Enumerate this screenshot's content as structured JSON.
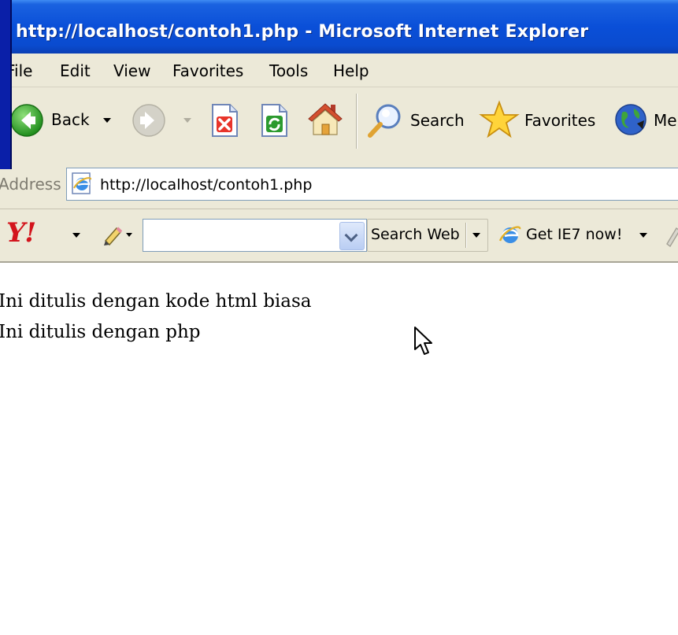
{
  "window": {
    "title": "http://localhost/contoh1.php - Microsoft Internet Explorer"
  },
  "menu": {
    "items": [
      "File",
      "Edit",
      "View",
      "Favorites",
      "Tools",
      "Help"
    ]
  },
  "toolbar": {
    "back_label": "Back",
    "search_label": "Search",
    "favorites_label": "Favorites",
    "media_label_partial": "Me"
  },
  "address": {
    "label": "Address",
    "url": "http://localhost/contoh1.php"
  },
  "yahoo": {
    "logo": "Y!",
    "search_value": "",
    "search_web_label": "Search Web",
    "ie7_label": "Get IE7 now!"
  },
  "content": {
    "line1": "Ini ditulis dengan kode html biasa",
    "line2": "Ini ditulis dengan php"
  },
  "colors": {
    "titlebar": "#0a4fd8",
    "chrome": "#ece9d8",
    "link_blue": "#1a62e0"
  }
}
